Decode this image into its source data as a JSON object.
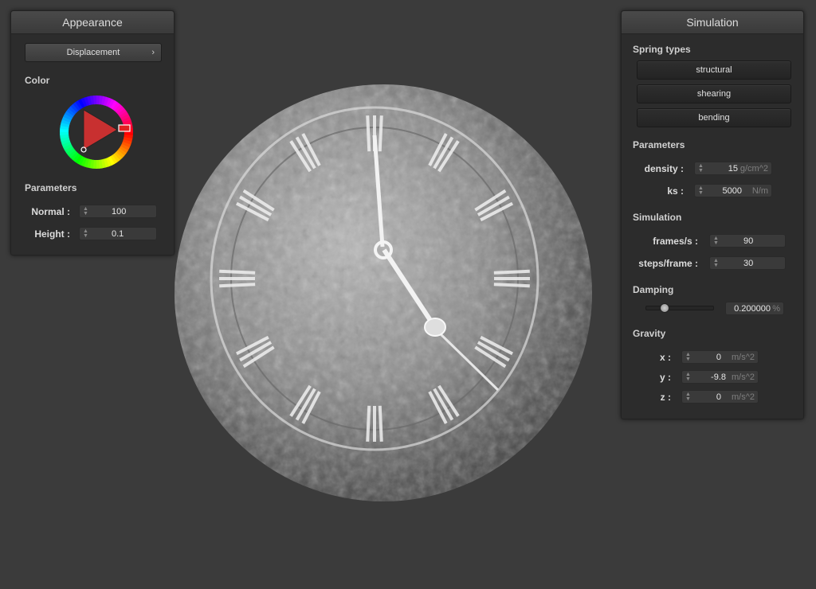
{
  "appearance": {
    "title": "Appearance",
    "shader_button": "Displacement",
    "color_label": "Color",
    "parameters_label": "Parameters",
    "normal": {
      "label": "Normal :",
      "value": "100"
    },
    "height": {
      "label": "Height :",
      "value": "0.1"
    }
  },
  "simulation": {
    "title": "Simulation",
    "spring_types_label": "Spring types",
    "springs": [
      "structural",
      "shearing",
      "bending"
    ],
    "parameters_label": "Parameters",
    "density": {
      "label": "density :",
      "value": "15",
      "unit": "g/cm^2"
    },
    "ks": {
      "label": "ks :",
      "value": "5000",
      "unit": "N/m"
    },
    "simulation_label": "Simulation",
    "frames": {
      "label": "frames/s :",
      "value": "90"
    },
    "steps": {
      "label": "steps/frame :",
      "value": "30"
    },
    "damping_label": "Damping",
    "damping": {
      "value": "0.200000",
      "unit": "%",
      "slider_fraction": 0.2
    },
    "gravity_label": "Gravity",
    "gx": {
      "label": "x :",
      "value": "0",
      "unit": "m/s^2"
    },
    "gy": {
      "label": "y :",
      "value": "-9.8",
      "unit": "m/s^2"
    },
    "gz": {
      "label": "z :",
      "value": "0",
      "unit": "m/s^2"
    }
  },
  "icons": {
    "chevron": "›",
    "spin": "▲▼"
  },
  "colors": {
    "background": "#3b3b3b",
    "selected_color": "#e02020"
  },
  "clock_numerals": [
    "XII",
    "I",
    "II",
    "III",
    "IV",
    "V",
    "VI",
    "VII",
    "VIII",
    "IX",
    "X",
    "XI"
  ]
}
